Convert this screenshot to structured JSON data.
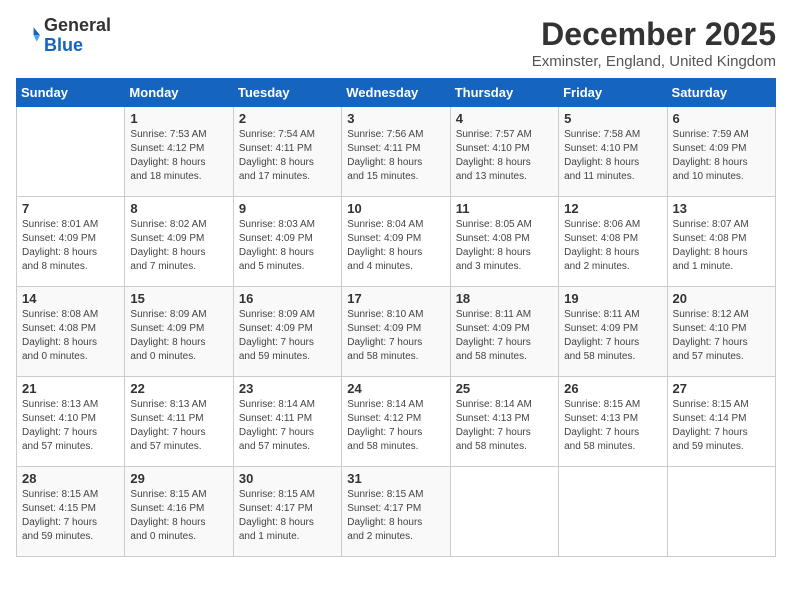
{
  "logo": {
    "general": "General",
    "blue": "Blue"
  },
  "title": {
    "month_year": "December 2025",
    "location": "Exminster, England, United Kingdom"
  },
  "days_of_week": [
    "Sunday",
    "Monday",
    "Tuesday",
    "Wednesday",
    "Thursday",
    "Friday",
    "Saturday"
  ],
  "weeks": [
    [
      {
        "day": "",
        "info": ""
      },
      {
        "day": "1",
        "info": "Sunrise: 7:53 AM\nSunset: 4:12 PM\nDaylight: 8 hours\nand 18 minutes."
      },
      {
        "day": "2",
        "info": "Sunrise: 7:54 AM\nSunset: 4:11 PM\nDaylight: 8 hours\nand 17 minutes."
      },
      {
        "day": "3",
        "info": "Sunrise: 7:56 AM\nSunset: 4:11 PM\nDaylight: 8 hours\nand 15 minutes."
      },
      {
        "day": "4",
        "info": "Sunrise: 7:57 AM\nSunset: 4:10 PM\nDaylight: 8 hours\nand 13 minutes."
      },
      {
        "day": "5",
        "info": "Sunrise: 7:58 AM\nSunset: 4:10 PM\nDaylight: 8 hours\nand 11 minutes."
      },
      {
        "day": "6",
        "info": "Sunrise: 7:59 AM\nSunset: 4:09 PM\nDaylight: 8 hours\nand 10 minutes."
      }
    ],
    [
      {
        "day": "7",
        "info": "Sunrise: 8:01 AM\nSunset: 4:09 PM\nDaylight: 8 hours\nand 8 minutes."
      },
      {
        "day": "8",
        "info": "Sunrise: 8:02 AM\nSunset: 4:09 PM\nDaylight: 8 hours\nand 7 minutes."
      },
      {
        "day": "9",
        "info": "Sunrise: 8:03 AM\nSunset: 4:09 PM\nDaylight: 8 hours\nand 5 minutes."
      },
      {
        "day": "10",
        "info": "Sunrise: 8:04 AM\nSunset: 4:09 PM\nDaylight: 8 hours\nand 4 minutes."
      },
      {
        "day": "11",
        "info": "Sunrise: 8:05 AM\nSunset: 4:08 PM\nDaylight: 8 hours\nand 3 minutes."
      },
      {
        "day": "12",
        "info": "Sunrise: 8:06 AM\nSunset: 4:08 PM\nDaylight: 8 hours\nand 2 minutes."
      },
      {
        "day": "13",
        "info": "Sunrise: 8:07 AM\nSunset: 4:08 PM\nDaylight: 8 hours\nand 1 minute."
      }
    ],
    [
      {
        "day": "14",
        "info": "Sunrise: 8:08 AM\nSunset: 4:08 PM\nDaylight: 8 hours\nand 0 minutes."
      },
      {
        "day": "15",
        "info": "Sunrise: 8:09 AM\nSunset: 4:09 PM\nDaylight: 8 hours\nand 0 minutes."
      },
      {
        "day": "16",
        "info": "Sunrise: 8:09 AM\nSunset: 4:09 PM\nDaylight: 7 hours\nand 59 minutes."
      },
      {
        "day": "17",
        "info": "Sunrise: 8:10 AM\nSunset: 4:09 PM\nDaylight: 7 hours\nand 58 minutes."
      },
      {
        "day": "18",
        "info": "Sunrise: 8:11 AM\nSunset: 4:09 PM\nDaylight: 7 hours\nand 58 minutes."
      },
      {
        "day": "19",
        "info": "Sunrise: 8:11 AM\nSunset: 4:09 PM\nDaylight: 7 hours\nand 58 minutes."
      },
      {
        "day": "20",
        "info": "Sunrise: 8:12 AM\nSunset: 4:10 PM\nDaylight: 7 hours\nand 57 minutes."
      }
    ],
    [
      {
        "day": "21",
        "info": "Sunrise: 8:13 AM\nSunset: 4:10 PM\nDaylight: 7 hours\nand 57 minutes."
      },
      {
        "day": "22",
        "info": "Sunrise: 8:13 AM\nSunset: 4:11 PM\nDaylight: 7 hours\nand 57 minutes."
      },
      {
        "day": "23",
        "info": "Sunrise: 8:14 AM\nSunset: 4:11 PM\nDaylight: 7 hours\nand 57 minutes."
      },
      {
        "day": "24",
        "info": "Sunrise: 8:14 AM\nSunset: 4:12 PM\nDaylight: 7 hours\nand 58 minutes."
      },
      {
        "day": "25",
        "info": "Sunrise: 8:14 AM\nSunset: 4:13 PM\nDaylight: 7 hours\nand 58 minutes."
      },
      {
        "day": "26",
        "info": "Sunrise: 8:15 AM\nSunset: 4:13 PM\nDaylight: 7 hours\nand 58 minutes."
      },
      {
        "day": "27",
        "info": "Sunrise: 8:15 AM\nSunset: 4:14 PM\nDaylight: 7 hours\nand 59 minutes."
      }
    ],
    [
      {
        "day": "28",
        "info": "Sunrise: 8:15 AM\nSunset: 4:15 PM\nDaylight: 7 hours\nand 59 minutes."
      },
      {
        "day": "29",
        "info": "Sunrise: 8:15 AM\nSunset: 4:16 PM\nDaylight: 8 hours\nand 0 minutes."
      },
      {
        "day": "30",
        "info": "Sunrise: 8:15 AM\nSunset: 4:17 PM\nDaylight: 8 hours\nand 1 minute."
      },
      {
        "day": "31",
        "info": "Sunrise: 8:15 AM\nSunset: 4:17 PM\nDaylight: 8 hours\nand 2 minutes."
      },
      {
        "day": "",
        "info": ""
      },
      {
        "day": "",
        "info": ""
      },
      {
        "day": "",
        "info": ""
      }
    ]
  ]
}
